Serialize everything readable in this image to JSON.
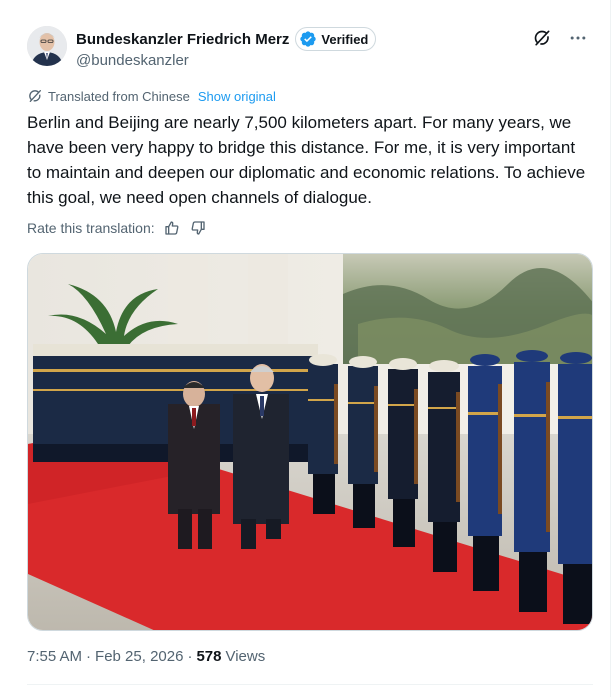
{
  "author": {
    "display_name": "Bundeskanzler Friedrich Merz",
    "verified_label": "Verified",
    "handle": "@bundeskanzler"
  },
  "translation": {
    "notice": "Translated from Chinese",
    "show_original": "Show original",
    "rate_label": "Rate this translation:"
  },
  "tweet": {
    "text": "Berlin and Beijing are nearly 7,500 kilometers apart. For many years, we have been very happy to bridge this distance. For me, it is very important to maintain and deepen our diplomatic and economic relations. To achieve this goal, we need open channels of dialogue."
  },
  "meta": {
    "time": "7:55 AM",
    "separator": "·",
    "date": "Feb 25, 2026",
    "separator2": "·",
    "views_count": "578",
    "views_label": "Views"
  },
  "icons": {
    "avatar": "avatar-portrait",
    "verified": "verified-badge-icon",
    "grok": "grok-icon",
    "more": "more-icon",
    "translate": "translate-icon",
    "thumbs_up": "thumbs-up-icon",
    "thumbs_down": "thumbs-down-icon"
  },
  "colors": {
    "accent": "#1d9bf0",
    "secondary_text": "#536471",
    "primary_text": "#0f1419",
    "carpet": "#d9292b",
    "uniform": "#1b2a45"
  }
}
